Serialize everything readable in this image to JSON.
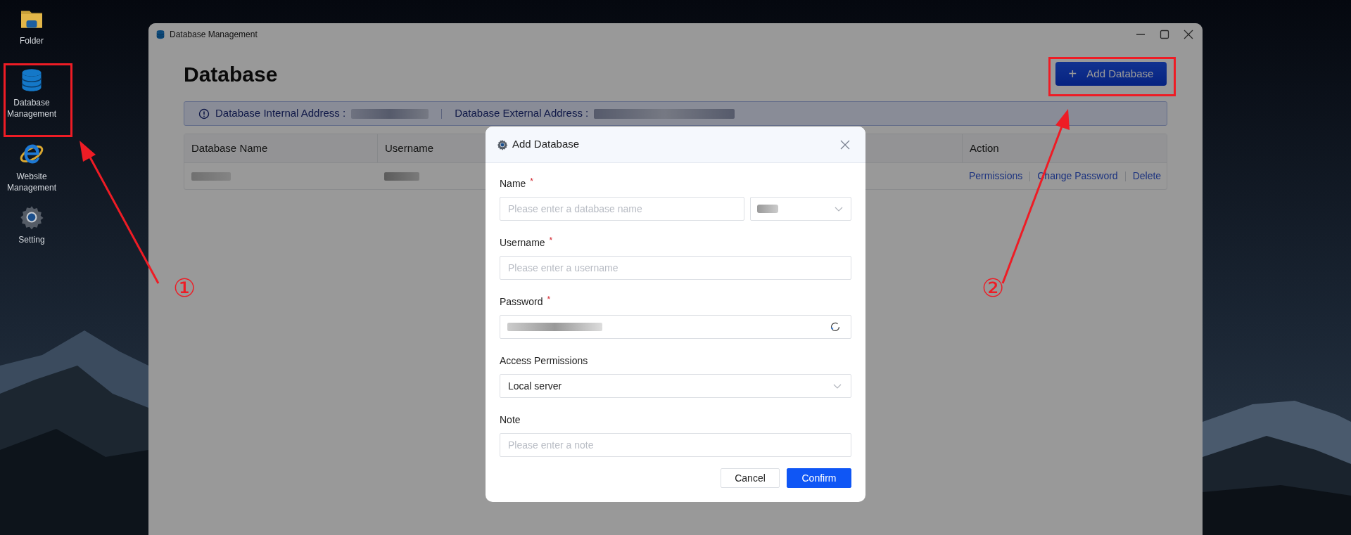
{
  "desktop": {
    "icons": [
      {
        "kind": "folder",
        "label": "Folder"
      },
      {
        "kind": "database",
        "label": "Database Management"
      },
      {
        "kind": "browser",
        "label": "Website Management"
      },
      {
        "kind": "gear",
        "label": "Setting"
      }
    ]
  },
  "window": {
    "title": "Database Management",
    "heading": "Database",
    "add_button": {
      "icon": "+",
      "label": "Add Database"
    },
    "info_bar": {
      "internal_label": "Database Internal Address :",
      "external_label": "Database External Address :"
    },
    "table": {
      "columns": [
        "Database Name",
        "Username",
        "Action"
      ],
      "rows": [
        {
          "actions": [
            "Permissions",
            "Change Password",
            "Delete"
          ]
        }
      ]
    }
  },
  "dialog": {
    "title": "Add Database",
    "fields": [
      {
        "kind": "text_with_select",
        "label": "Name",
        "required_mark": "*",
        "placeholder": "Please enter a database name"
      },
      {
        "kind": "text",
        "label": "Username",
        "required_mark": "*",
        "placeholder": "Please enter a username"
      },
      {
        "kind": "password",
        "label": "Password",
        "required_mark": "*"
      },
      {
        "kind": "select",
        "label": "Access Permissions",
        "value": "Local server"
      },
      {
        "kind": "text",
        "label": "Note",
        "placeholder": "Please enter a note"
      }
    ],
    "buttons": [
      {
        "kind": "secondary",
        "label": "Cancel"
      },
      {
        "kind": "primary",
        "label": "Confirm"
      }
    ]
  },
  "annotations": {
    "markers": [
      "①",
      "②"
    ]
  }
}
